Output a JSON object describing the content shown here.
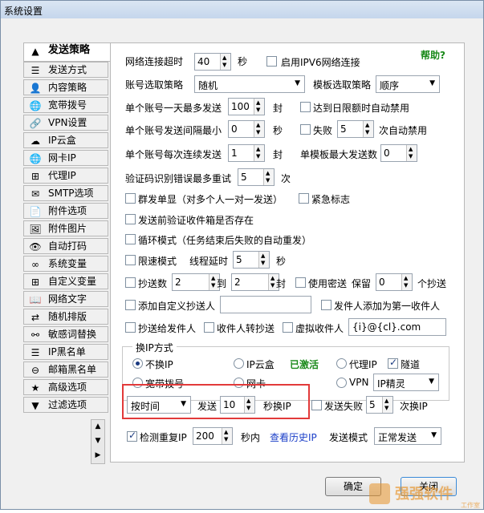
{
  "window": {
    "title": "系统设置"
  },
  "sidebar": {
    "items": [
      {
        "label": "发送策略",
        "icon": "send-strategy-icon",
        "glyph": "▲"
      },
      {
        "label": "发送方式",
        "icon": "list-icon",
        "glyph": "☰"
      },
      {
        "label": "内容策略",
        "icon": "user-content-icon",
        "glyph": "👤"
      },
      {
        "label": "宽带拨号",
        "icon": "globe-icon",
        "glyph": "🌐"
      },
      {
        "label": "VPN设置",
        "icon": "link-icon",
        "glyph": "🔗"
      },
      {
        "label": "IP云盒",
        "icon": "cloud-icon",
        "glyph": "☁"
      },
      {
        "label": "网卡IP",
        "icon": "network-globe-icon",
        "glyph": "🌐"
      },
      {
        "label": "代理IP",
        "icon": "sitemap-icon",
        "glyph": "⊞"
      },
      {
        "label": "SMTP选项",
        "icon": "envelope-icon",
        "glyph": "✉"
      },
      {
        "label": "附件选项",
        "icon": "document-icon",
        "glyph": "📄"
      },
      {
        "label": "附件图片",
        "icon": "image-icon",
        "glyph": "🖼"
      },
      {
        "label": "自动打码",
        "icon": "eye-icon",
        "glyph": "👁"
      },
      {
        "label": "系统变量",
        "icon": "infinity-icon",
        "glyph": "∞"
      },
      {
        "label": "自定义变量",
        "icon": "grid-icon",
        "glyph": "⊞"
      },
      {
        "label": "网络文字",
        "icon": "book-icon",
        "glyph": "📖"
      },
      {
        "label": "随机排版",
        "icon": "shuffle-icon",
        "glyph": "⇄"
      },
      {
        "label": "敏感词替换",
        "icon": "share-nodes-icon",
        "glyph": "⚯"
      },
      {
        "label": "IP黑名单",
        "icon": "blacklist-icon",
        "glyph": "☰"
      },
      {
        "label": "邮箱黑名单",
        "icon": "blocked-icon",
        "glyph": "⊖"
      },
      {
        "label": "高级选项",
        "icon": "star-icon",
        "glyph": "★"
      },
      {
        "label": "过滤选项",
        "icon": "filter-icon",
        "glyph": "▼"
      }
    ]
  },
  "main": {
    "help": "帮助?",
    "timeout_label": "网络连接超时",
    "timeout_value": "40",
    "timeout_unit": "秒",
    "ipv6_label": "启用IPV6网络连接",
    "account_strategy_label": "账号选取策略",
    "account_strategy_value": "随机",
    "template_strategy_label": "模板选取策略",
    "template_strategy_value": "顺序",
    "max_per_day_label": "单个账号一天最多发送",
    "max_per_day_value": "100",
    "max_per_day_unit": "封",
    "daily_limit_label": "达到日限额时自动禁用",
    "interval_label": "单个账号发送间隔最小",
    "interval_value": "0",
    "interval_unit": "秒",
    "fail_label": "失败",
    "fail_value": "5",
    "fail_suffix": "次自动禁用",
    "consecutive_label": "单个账号每次连续发送",
    "consecutive_value": "1",
    "consecutive_unit": "封",
    "template_max_label": "单模板最大发送数",
    "template_max_value": "0",
    "captcha_label": "验证码识别错误最多重试",
    "captcha_value": "5",
    "captcha_unit": "次",
    "group_single_label": "群发单显（对多个人一对一发送）",
    "urgent_label": "紧急标志",
    "verify_label": "发送前验证收件箱是否存在",
    "loop_label": "循环模式（任务结束后失败的自动重发）",
    "speed_label": "限速模式",
    "thread_delay_label": "线程延时",
    "thread_delay_value": "5",
    "thread_delay_unit": "秒",
    "cc_count_label": "抄送数",
    "cc_from": "2",
    "cc_to_label": "到",
    "cc_to": "2",
    "cc_unit": "封",
    "secret_cc_label": "使用密送",
    "keep_label": "保留",
    "keep_value": "0",
    "keep_unit": "个抄送",
    "add_cc_label": "添加自定义抄送人",
    "add_cc_value": "",
    "sender_first_label": "发件人添加为第一收件人",
    "cc_sender_label": "抄送给发件人",
    "recipient_to_cc_label": "收件人转抄送",
    "virtual_recipient_label": "虚拟收件人",
    "virtual_recipient_value": "{i}@{cl}.com",
    "ip_switch": {
      "legend": "换IP方式",
      "no_change": "不换IP",
      "ip_cloud": "IP云盒",
      "activated": "已激活",
      "proxy_ip": "代理IP",
      "tunnel": "隧道",
      "broadband": "宽带拨号",
      "nic": "网卡",
      "vpn": "VPN",
      "vpn_select": "IP精灵"
    },
    "by_time_select": "按时间",
    "send_label": "发送",
    "send_value": "10",
    "switch_ip_label": "秒换IP",
    "send_fail_label": "发送失败",
    "send_fail_value": "5",
    "send_fail_suffix": "次换IP",
    "dup_check_label": "检测重复IP",
    "dup_check_value": "200",
    "dup_check_unit": "秒内",
    "history_link": "查看历史IP",
    "send_mode_label": "发送模式",
    "send_mode_value": "正常发送"
  },
  "footer": {
    "ok": "确定",
    "close": "关闭"
  },
  "watermark": {
    "brand": "强强软件",
    "sub": "工作室"
  }
}
